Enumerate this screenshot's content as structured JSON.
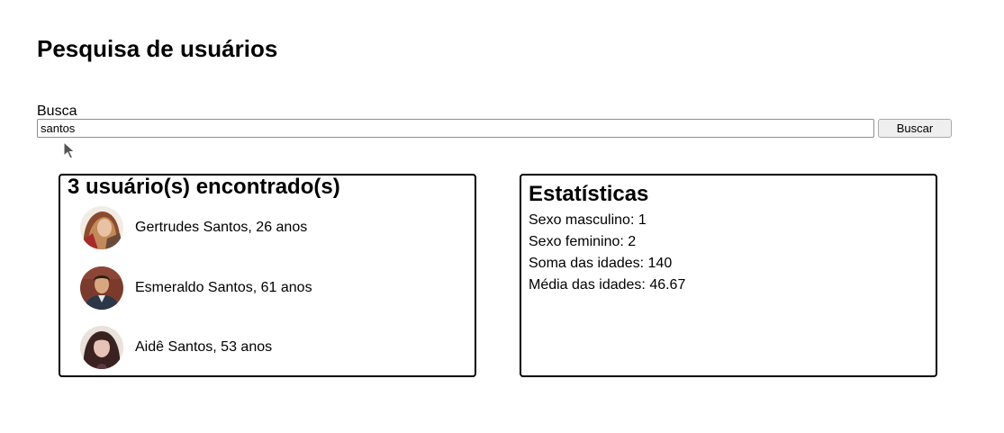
{
  "page": {
    "title": "Pesquisa de usuários"
  },
  "search": {
    "label": "Busca",
    "value": "santos",
    "button_label": "Buscar"
  },
  "results": {
    "heading": "3 usuário(s) encontrado(s)",
    "users": [
      {
        "text": "Gertrudes Santos, 26 anos"
      },
      {
        "text": "Esmeraldo Santos, 61 anos"
      },
      {
        "text": "Aidê Santos, 53 anos"
      }
    ]
  },
  "stats": {
    "heading": "Estatísticas",
    "lines": [
      {
        "label": "Sexo masculino:",
        "value": "1"
      },
      {
        "label": "Sexo feminino:",
        "value": "2"
      },
      {
        "label": "Soma das idades:",
        "value": "140"
      },
      {
        "label": "Média das idades:",
        "value": "46.67"
      }
    ]
  }
}
